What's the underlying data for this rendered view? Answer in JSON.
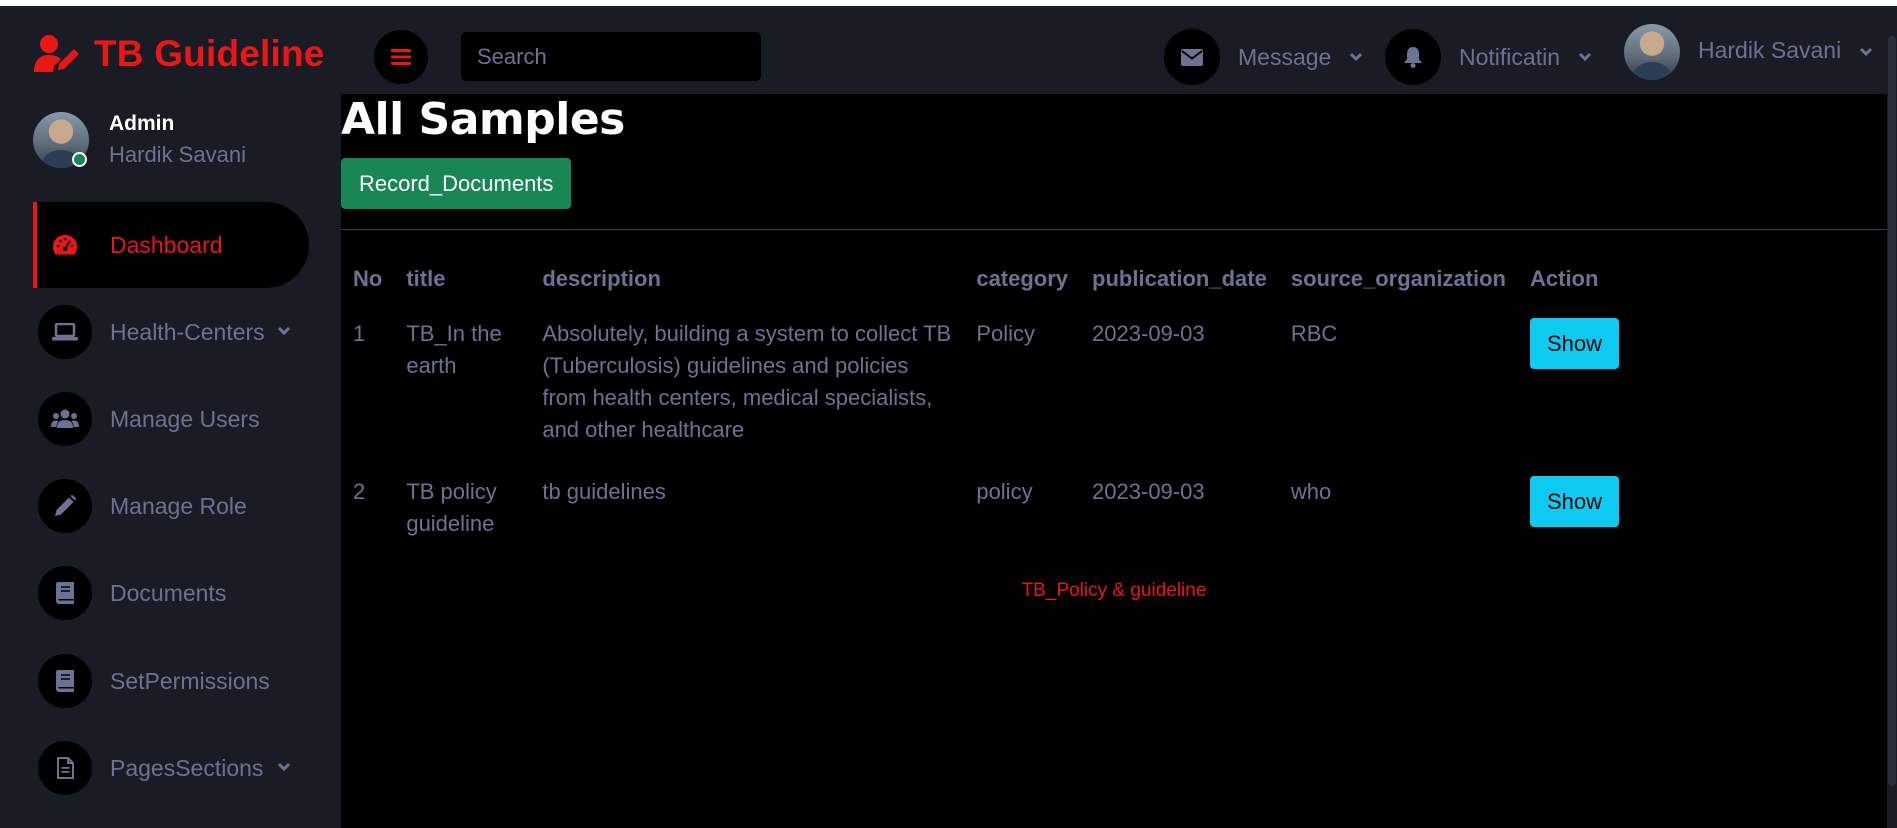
{
  "brand": {
    "name": "TB Guideline",
    "icon": "user-edit-icon",
    "color": "#eb1616"
  },
  "topbar": {
    "menu_icon": "bars-icon",
    "search": {
      "placeholder": "Search",
      "value": ""
    },
    "message": {
      "label": "Message",
      "icon": "envelope-icon"
    },
    "notification": {
      "label": "Notificatin",
      "icon": "bell-icon"
    },
    "user": {
      "name": "Hardik Savani"
    }
  },
  "sidebar": {
    "profile": {
      "role": "Admin",
      "name": "Hardik Savani",
      "status": "online"
    },
    "items": [
      {
        "label": "Dashboard",
        "icon": "tachometer-icon",
        "active": true,
        "has_submenu": false
      },
      {
        "label": "Health-Centers",
        "icon": "laptop-icon",
        "active": false,
        "has_submenu": true
      },
      {
        "label": "Manage Users",
        "icon": "users-icon",
        "active": false,
        "has_submenu": false
      },
      {
        "label": "Manage Role",
        "icon": "pencil-icon",
        "active": false,
        "has_submenu": false
      },
      {
        "label": "Documents",
        "icon": "book-icon",
        "active": false,
        "has_submenu": false
      },
      {
        "label": "SetPermissions",
        "icon": "book-icon",
        "active": false,
        "has_submenu": false
      },
      {
        "label": "PagesSections",
        "icon": "file-alt-icon",
        "active": false,
        "has_submenu": true
      }
    ]
  },
  "main": {
    "title": "All Samples",
    "record_button": "Record_Documents",
    "table": {
      "headers": [
        "No",
        "title",
        "description",
        "category",
        "publication_date",
        "source_organization",
        "Action"
      ],
      "rows": [
        {
          "no": "1",
          "title": "TB_In the earth",
          "description": "Absolutely, building a system to collect TB (Tuberculosis) guidelines and policies from health centers, medical specialists, and other healthcare",
          "category": "Policy",
          "publication_date": "2023-09-03",
          "source_organization": "RBC",
          "action": "Show"
        },
        {
          "no": "2",
          "title": "TB policy guideline",
          "description": "tb guidelines",
          "category": "policy",
          "publication_date": "2023-09-03",
          "source_organization": "who",
          "action": "Show"
        }
      ]
    },
    "footer": "TB_Policy & guideline"
  },
  "colors": {
    "accent": "#eb1616",
    "panel": "#191c24",
    "muted_text": "#6c7293",
    "success": "#198754",
    "info": "#0dcaf0"
  }
}
